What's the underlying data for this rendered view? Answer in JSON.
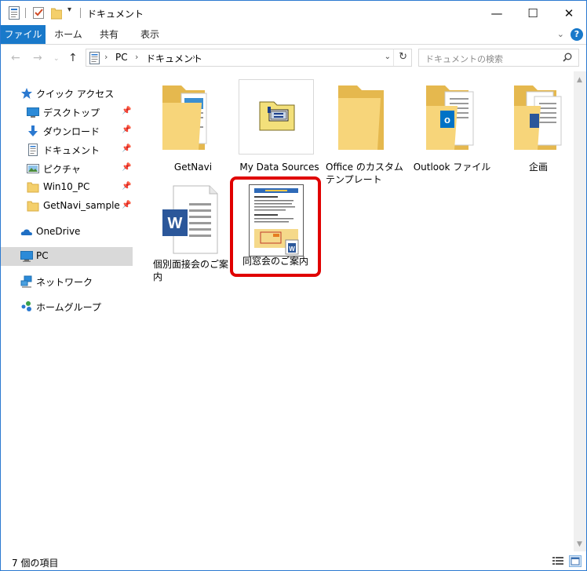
{
  "window": {
    "title": "ドキュメント",
    "controls": {
      "minimize": "—",
      "maximize": "☐",
      "close": "✕"
    }
  },
  "ribbon": {
    "tabs": [
      "ファイル",
      "ホーム",
      "共有",
      "表示"
    ],
    "help": "?"
  },
  "address": {
    "crumbs": [
      "PC",
      "ドキュメント"
    ]
  },
  "search": {
    "placeholder": "ドキュメントの検索"
  },
  "sidebar": {
    "quick_access": "クイック アクセス",
    "pinned": [
      "デスクトップ",
      "ダウンロード",
      "ドキュメント",
      "ピクチャ",
      "Win10_PC",
      "GetNavi_sample"
    ],
    "onedrive": "OneDrive",
    "pc": "PC",
    "network": "ネットワーク",
    "homegroup": "ホームグループ"
  },
  "files": [
    {
      "name": "GetNavi",
      "type": "folder-docs"
    },
    {
      "name": "My Data Sources",
      "type": "datasource"
    },
    {
      "name": "Office のカスタム テンプレート",
      "type": "folder-empty"
    },
    {
      "name": "Outlook ファイル",
      "type": "folder-outlook"
    },
    {
      "name": "企画",
      "type": "folder-docs"
    },
    {
      "name": "個別面接会のご案内",
      "type": "word-doc"
    },
    {
      "name": "同窓会のご案内",
      "type": "word-preview",
      "highlighted": true
    }
  ],
  "colors": {
    "accent": "#1979ca",
    "highlight": "#e00000",
    "folder": "#f4cf6b",
    "word": "#2b579a"
  },
  "status": {
    "count_text": "7 個の項目"
  }
}
